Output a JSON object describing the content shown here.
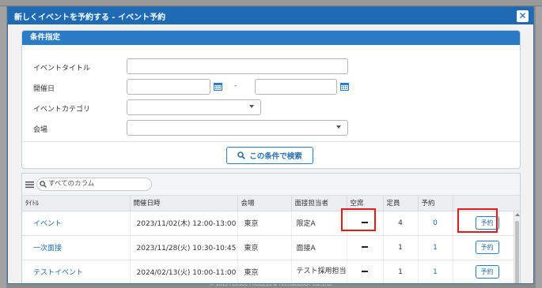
{
  "background": {
    "footer": "© 2015 PERSOL PROCESS & TECHNOLOGY CO.,LTD."
  },
  "modal": {
    "title": "新しくイベントを予約する - イベント予約",
    "close_label": "✕"
  },
  "conditions": {
    "header": "条件指定",
    "event_title_label": "イベントタイトル",
    "date_label": "開催日",
    "date_separator": "-",
    "category_label": "イベントカテゴリ",
    "venue_label": "会場",
    "search_button": "この条件で検索"
  },
  "grid": {
    "search_placeholder": "すべてのカラム",
    "columns": [
      "ﾀｲﾄﾙ",
      "開催日時",
      "会場",
      "面接担当者",
      "空席",
      "定員",
      "予約",
      ""
    ],
    "reserve_label": "予約",
    "rows": [
      {
        "title": "イベント",
        "datetime": "2023/11/02(木) 12:00-13:00",
        "venue": "東京",
        "interviewer": "限定A",
        "capacity": "4",
        "reserved": "0"
      },
      {
        "title": "一次面接",
        "datetime": "2023/11/28(火) 10:30-10:45",
        "venue": "東京",
        "interviewer": "面接A",
        "capacity": "1",
        "reserved": "1"
      },
      {
        "title": "テストイベント",
        "datetime": "2024/02/13(火) 10:00-11:00",
        "venue": "東京",
        "interviewer": "テスト採用担当",
        "capacity": "1",
        "reserved": "1"
      }
    ]
  },
  "colors": {
    "header_blue": "#1f6bb3",
    "highlight_red": "#e01b1b"
  }
}
